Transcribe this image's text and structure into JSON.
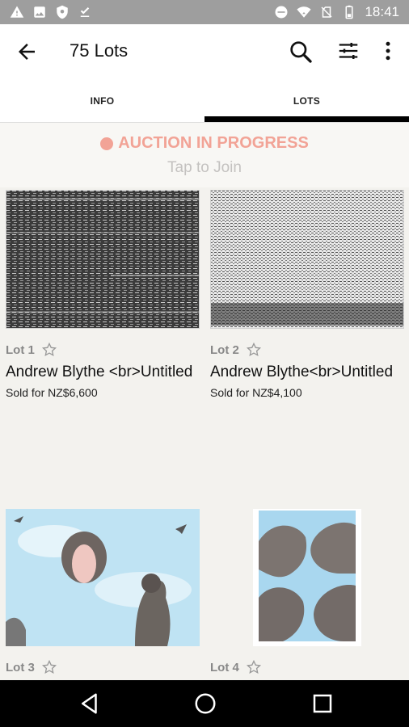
{
  "status_bar": {
    "time": "18:41",
    "left_icons": [
      "alert-icon",
      "image-icon",
      "shield-icon",
      "download-done-icon"
    ],
    "right_icons": [
      "dnd-icon",
      "wifi-icon",
      "no-sim-icon",
      "battery-icon"
    ]
  },
  "app_bar": {
    "title": "75 Lots"
  },
  "tabs": [
    {
      "label": "INFO",
      "active": false
    },
    {
      "label": "LOTS",
      "active": true
    }
  ],
  "banner": {
    "status": "AUCTION IN PROGRESS",
    "subtitle": "Tap to Join",
    "accent": "#f2a396"
  },
  "lots": [
    {
      "lot": "Lot 1",
      "artist": "Andrew Blythe <br>Untitled",
      "sold": "Sold for NZ$6,600"
    },
    {
      "lot": "Lot 2",
      "artist": "Andrew Blythe<br>Untitled",
      "sold": "Sold for NZ$4,100"
    },
    {
      "lot": "Lot 3",
      "artist": "",
      "sold": ""
    },
    {
      "lot": "Lot 4",
      "artist": "",
      "sold": ""
    }
  ]
}
